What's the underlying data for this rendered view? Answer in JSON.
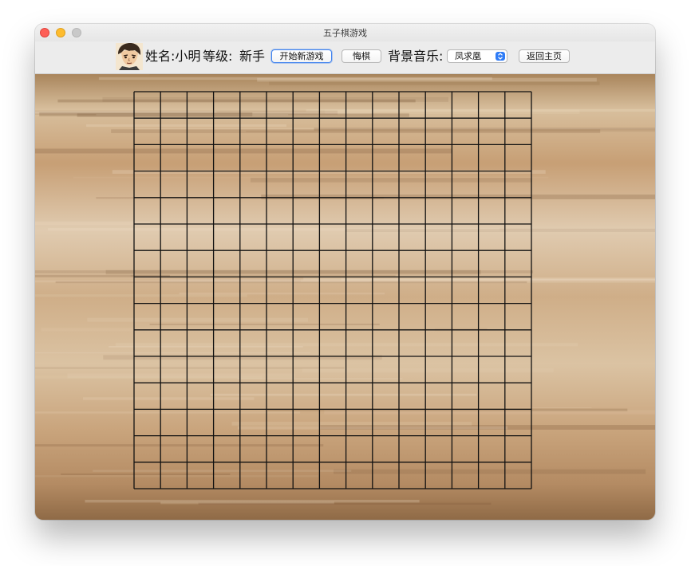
{
  "window": {
    "title": "五子棋游戏"
  },
  "toolbar": {
    "name_text": "姓名:小明",
    "level_label": "等级:",
    "level_value": "新手",
    "new_game_label": "开始新游戏",
    "undo_label": "悔棋",
    "music_label": "背景音乐:",
    "music_selected": "凤求凰",
    "back_home_label": "返回主页"
  },
  "board": {
    "lines": 16,
    "stones": []
  },
  "colors": {
    "accent": "#3f82ee",
    "grid_line": "#111111",
    "wood_base": "#c8a479"
  },
  "icons": [
    "close-icon",
    "minimize-icon",
    "maximize-icon",
    "avatar",
    "select-chevron-icon"
  ]
}
